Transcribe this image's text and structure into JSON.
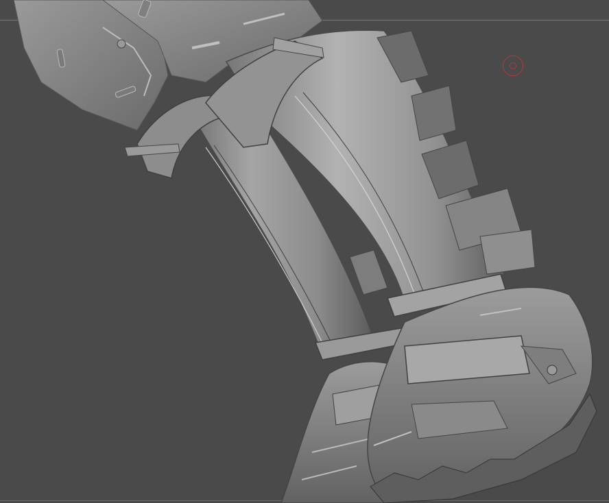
{
  "app": {
    "background_color": "#4a4a4a",
    "model_surface_color": "#8a8a8a",
    "highlight_color": "#b8b8b8",
    "shadow_color": "#3c3c3c"
  },
  "viewport": {
    "subject": "sculpted-armored-legs-and-boots"
  },
  "cursor": {
    "icon": "brush-cursor-icon",
    "color": "#b33a3a"
  }
}
